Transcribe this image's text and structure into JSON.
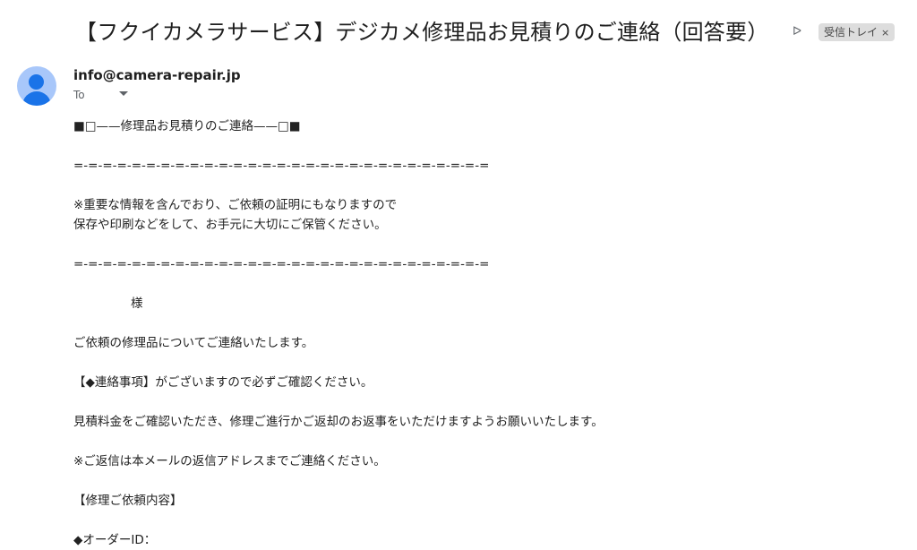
{
  "email": {
    "subject": "【フクイカメラサービス】デジカメ修理品お見積りのご連絡（回答要）",
    "important_icon": "importance-marker",
    "label": "受信トレイ",
    "label_close": "×",
    "sender": "info@camera-repair.jp",
    "to_label": "To"
  },
  "body": {
    "l1": "■□——修理品お見積りのご連絡——□■",
    "sep1": "=-=-=-=-=-=-=-=-=-=-=-=-=-=-=-=-=-=-=-=-=-=-=-=-=-=-=-=-=",
    "l2": "※重要な情報を含んでおり、ご依頼の証明にもなりますので",
    "l3": "保存や印刷などをして、お手元に大切にご保管ください。",
    "sep2": "=-=-=-=-=-=-=-=-=-=-=-=-=-=-=-=-=-=-=-=-=-=-=-=-=-=-=-=-=",
    "l4": "様",
    "l5": "ご依頼の修理品についてご連絡いたします。",
    "l6": "【◆連絡事項】がございますので必ずご確認ください。",
    "l7": "見積料金をご確認いただき、修理ご進行かご返却のお返事をいただけますようお願いいたします。",
    "l8": "※ご返信は本メールの返信アドレスまでご連絡ください。",
    "l9": "【修理ご依頼内容】",
    "l10": "◆オーダーID："
  }
}
